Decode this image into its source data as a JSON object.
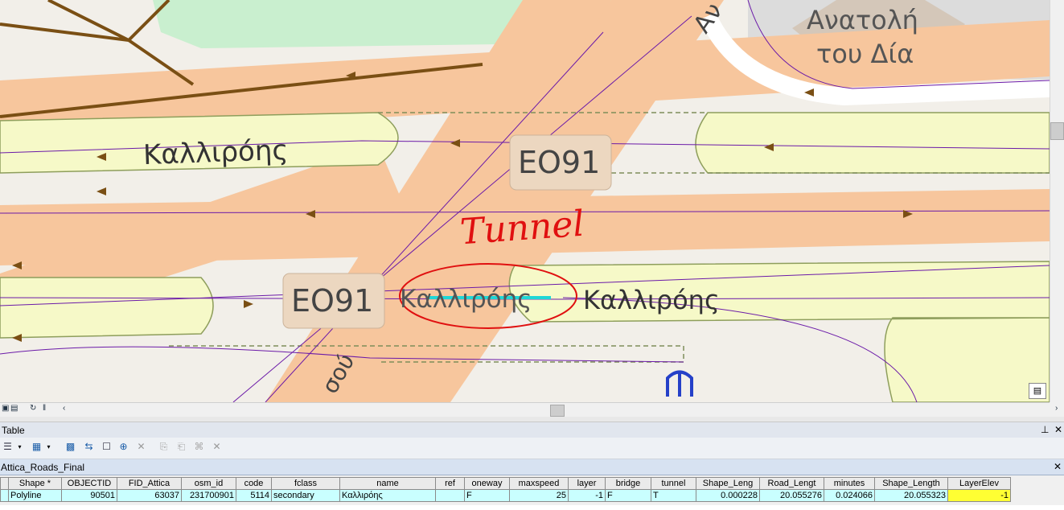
{
  "map": {
    "road_labels": {
      "kallirois_top_left": "Καλλιρόης",
      "kallirois_tunnel": "Καλλιρόης",
      "kallirois_right": "Καλλιρόης",
      "anat_fragment": "Αν",
      "sou_fragment": "σού"
    },
    "shield_top": "ΕΟ91",
    "shield_bottom": "ΕΟ91",
    "area_label_line1": "Ανατολή",
    "area_label_line2": "του Δία",
    "annotation_text": "Tunnel",
    "metro_icon": "metro-icon"
  },
  "table_window": {
    "title": "Table",
    "pin_icon": "pin-icon",
    "close_icon": "close-icon"
  },
  "layer_tab": {
    "name": "Attica_Roads_Final"
  },
  "attribute_table": {
    "columns": [
      "Shape *",
      "OBJECTID",
      "FID_Attica",
      "osm_id",
      "code",
      "fclass",
      "name",
      "ref",
      "oneway",
      "maxspeed",
      "layer",
      "bridge",
      "tunnel",
      "Shape_Leng",
      "Road_Lengt",
      "minutes",
      "Shape_Length",
      "LayerElev"
    ],
    "rows": [
      [
        "Polyline",
        "90501",
        "63037",
        "231700901",
        "5114",
        "secondary",
        "Καλλιρόης",
        "",
        "F",
        "25",
        "-1",
        "F",
        "T",
        "0.000228",
        "20.055276",
        "0.024066",
        "20.055323",
        "-1"
      ]
    ]
  },
  "colors": {
    "road_orange": "#f7c69d",
    "road_yellow": "#f6f9c8",
    "highlight_yellow": "#ffff33",
    "row_cyan": "#c9ffff",
    "annotation_red": "#e01010",
    "selected_segment_cyan": "#1fd6d6"
  }
}
